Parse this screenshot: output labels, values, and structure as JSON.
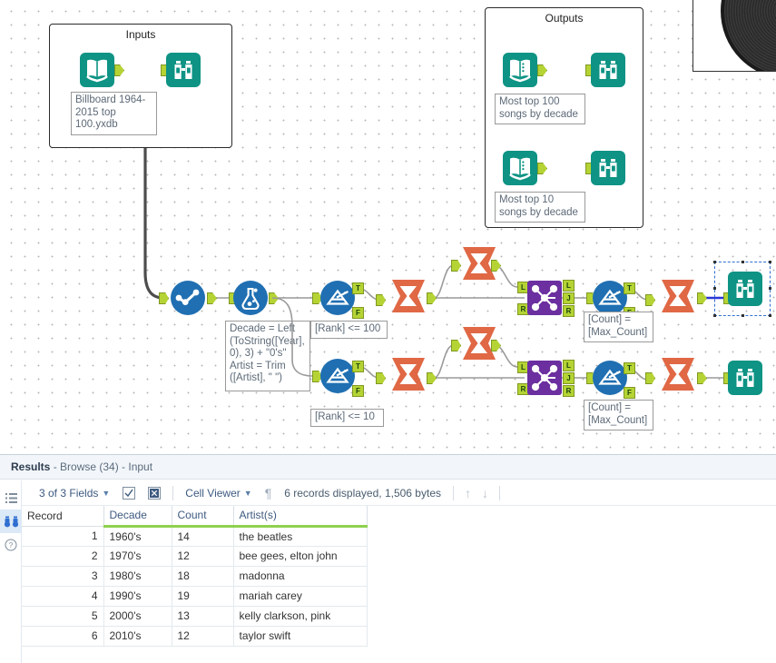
{
  "canvas": {
    "containers": [
      {
        "title": "Inputs"
      },
      {
        "title": "Outputs"
      }
    ],
    "annotations": {
      "input_file": "Billboard 1964-\n2015 top\n100.yxdb",
      "output_top100": "Most top 100\nsongs by decade",
      "output_top10": "Most top 10\nsongs by decade",
      "formula": "Decade = Left\n(ToString([Year],\n0), 3) + \"0's\"\nArtist = Trim\n([Artist], \" \")",
      "filter_top100": "[Rank] <= 100",
      "filter_top10": "[Rank] <= 10",
      "join_filter_top": "[Count] =\n[Max_Count]",
      "join_filter_bottom": "[Count] =\n[Max_Count]"
    },
    "anchor_labels": {
      "true": "T",
      "false": "F",
      "left": "L",
      "right": "R",
      "join": "J"
    },
    "tool_names": {
      "input_data": "input-data-tool",
      "browse": "browse-tool",
      "output_data": "output-data-tool",
      "select": "select-tool",
      "formula": "formula-tool",
      "filter": "filter-tool",
      "summarize": "summarize-tool",
      "join": "join-tool"
    },
    "colors": {
      "teal": "#0e9384",
      "blue": "#1f6fb2",
      "orange": "#e06845",
      "purple": "#6b2fa0",
      "anchor_green": "#b5d334",
      "selection_blue": "#2f6fd0"
    }
  },
  "results": {
    "header_bold": "Results",
    "header_rest": " - Browse (34) - Input",
    "toolbar": {
      "fields": "3 of 3 Fields",
      "viewer": "Cell Viewer",
      "records": "6 records displayed, 1,506 bytes",
      "pilcrow": "¶",
      "check_icon": "✓",
      "x_icon": "☒",
      "up_arrow": "↑",
      "down_arrow": "↓"
    },
    "rail": {
      "list_icon": "☰",
      "browse_icon": "⚇",
      "help_icon": "?"
    },
    "table": {
      "columns": [
        "Record",
        "Decade",
        "Count",
        "Artist(s)"
      ],
      "rows": [
        {
          "record": "1",
          "decade": "1960's",
          "count": "14",
          "artist": "the beatles"
        },
        {
          "record": "2",
          "decade": "1970's",
          "count": "12",
          "artist": "bee gees, elton john"
        },
        {
          "record": "3",
          "decade": "1980's",
          "count": "18",
          "artist": "madonna"
        },
        {
          "record": "4",
          "decade": "1990's",
          "count": "19",
          "artist": "mariah carey"
        },
        {
          "record": "5",
          "decade": "2000's",
          "count": "13",
          "artist": "kelly clarkson, pink"
        },
        {
          "record": "6",
          "decade": "2010's",
          "count": "12",
          "artist": "taylor swift"
        }
      ]
    }
  }
}
